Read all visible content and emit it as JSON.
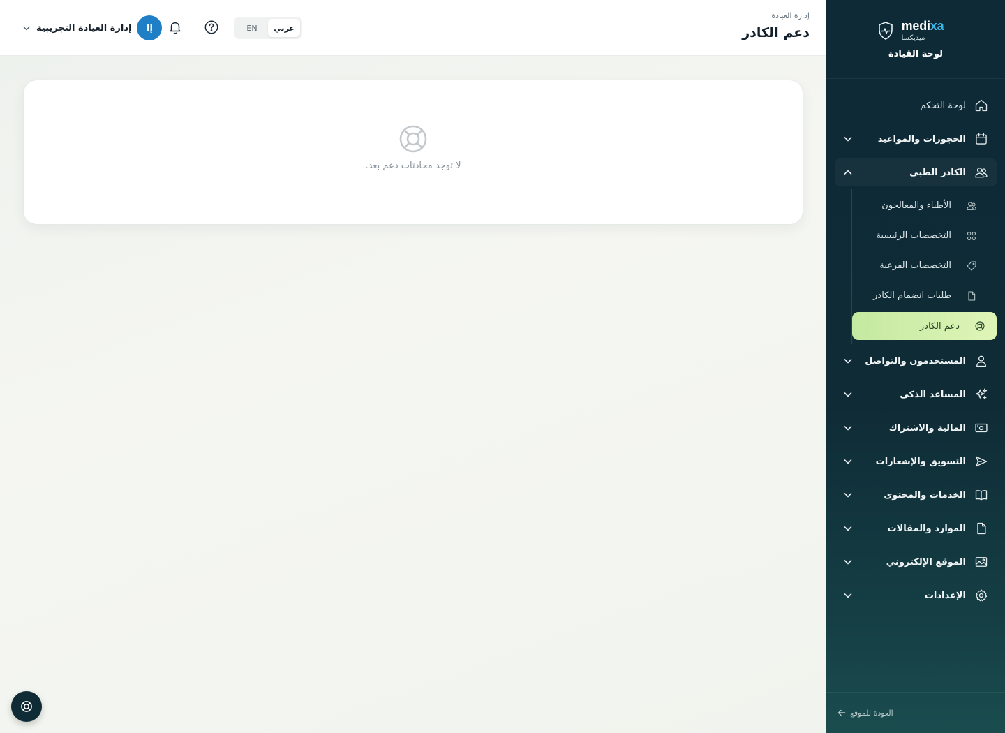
{
  "brand": {
    "name_en_main": "medi",
    "name_en_accent": "xa",
    "name_ar": "ميديكسا",
    "subtitle": "لوحة القيادة"
  },
  "sidebar": {
    "items": [
      {
        "label": "لوحة التحكم",
        "icon": "home-icon"
      },
      {
        "label": "الحجوزات والمواعيد",
        "icon": "calendar-icon"
      },
      {
        "label": "الكادر الطبي",
        "icon": "users-icon"
      },
      {
        "label": "المستخدمون والتواصل",
        "icon": "user-icon"
      },
      {
        "label": "المساعد الذكي",
        "icon": "sparkles-icon"
      },
      {
        "label": "المالية والاشتراك",
        "icon": "money-icon"
      },
      {
        "label": "التسويق والإشعارات",
        "icon": "send-icon"
      },
      {
        "label": "الخدمات والمحتوى",
        "icon": "book-icon"
      },
      {
        "label": "الموارد والمقالات",
        "icon": "file-icon"
      },
      {
        "label": "الموقع الإلكتروني",
        "icon": "image-icon"
      },
      {
        "label": "الإعدادات",
        "icon": "gear-icon"
      }
    ],
    "submenu": [
      {
        "label": "الأطباء والمعالجون",
        "icon": "users-icon"
      },
      {
        "label": "التخصصات الرئيسية",
        "icon": "grid-icon"
      },
      {
        "label": "التخصصات الفرعية",
        "icon": "tag-icon"
      },
      {
        "label": "طلبات انضمام الكادر",
        "icon": "file-icon"
      },
      {
        "label": "دعم الكادر",
        "icon": "lifebuoy-icon"
      }
    ],
    "footer_link": "العودة للموقع"
  },
  "header": {
    "breadcrumb": "إدارة العيادة",
    "title": "دعم الكادر",
    "user_name": "إدارة العيادة التجريبية",
    "avatar_initials": "إا",
    "lang_en": "EN",
    "lang_ar": "عربي"
  },
  "main": {
    "empty_message": "لا توجد محادثات دعم بعد."
  },
  "colors": {
    "sidebar_bg": "#0e2a36",
    "accent": "#1e7fc6",
    "active_item": "#c4e9a0"
  }
}
